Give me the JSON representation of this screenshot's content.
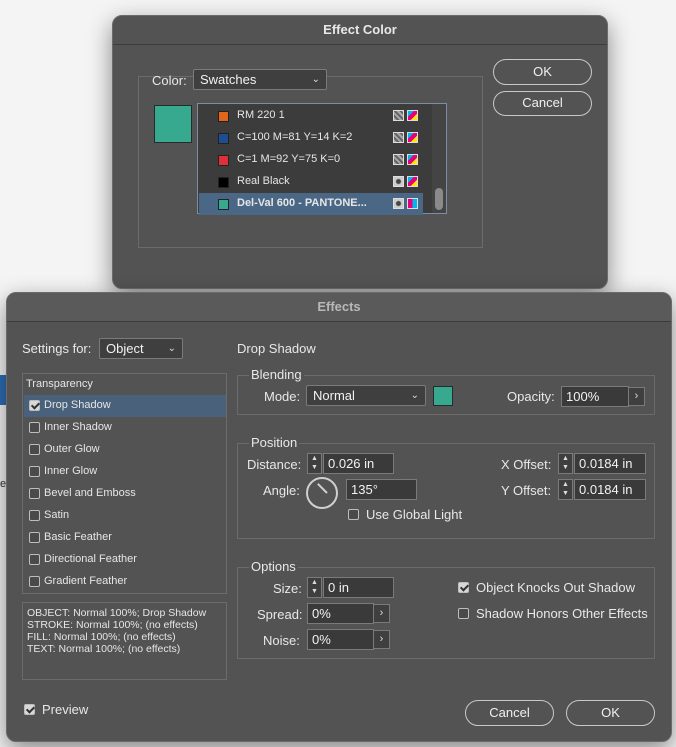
{
  "effect_color": {
    "title": "Effect Color",
    "color_label": "Color:",
    "color_value": "Swatches",
    "ok": "OK",
    "cancel": "Cancel",
    "preview_color": "#37a98f",
    "swatches": [
      {
        "name": "RM 220 1",
        "color": "#e0661c"
      },
      {
        "name": "C=100 M=81 Y=14 K=2",
        "color": "#1e4e92"
      },
      {
        "name": "C=1 M=92 Y=75 K=0",
        "color": "#df2f3a"
      },
      {
        "name": "Real Black",
        "color": "#000000"
      },
      {
        "name": "Del-Val 600 - PANTONE...",
        "color": "#37a98f",
        "selected": true
      }
    ]
  },
  "effects": {
    "title": "Effects",
    "settings_for_label": "Settings for:",
    "settings_for_value": "Object",
    "list_header": "Transparency",
    "items": [
      {
        "label": "Drop Shadow",
        "checked": true,
        "selected": true
      },
      {
        "label": "Inner Shadow",
        "checked": false
      },
      {
        "label": "Outer Glow",
        "checked": false
      },
      {
        "label": "Inner Glow",
        "checked": false
      },
      {
        "label": "Bevel and Emboss",
        "checked": false
      },
      {
        "label": "Satin",
        "checked": false
      },
      {
        "label": "Basic Feather",
        "checked": false
      },
      {
        "label": "Directional Feather",
        "checked": false
      },
      {
        "label": "Gradient Feather",
        "checked": false
      }
    ],
    "summary": [
      "OBJECT: Normal 100%; Drop Shadow",
      "STROKE: Normal 100%; (no effects)",
      "FILL: Normal 100%; (no effects)",
      "TEXT: Normal 100%; (no effects)"
    ],
    "preview_label": "Preview",
    "preview_checked": true,
    "panel_title": "Drop Shadow",
    "blending": {
      "title": "Blending",
      "mode_label": "Mode:",
      "mode_value": "Normal",
      "swatch_color": "#37a98f",
      "opacity_label": "Opacity:",
      "opacity_value": "100%"
    },
    "position": {
      "title": "Position",
      "distance_label": "Distance:",
      "distance_value": "0.026 in",
      "angle_label": "Angle:",
      "angle_value": "135°",
      "use_global_light": "Use Global Light",
      "x_offset_label": "X Offset:",
      "x_offset_value": "0.0184 in",
      "y_offset_label": "Y Offset:",
      "y_offset_value": "0.0184 in"
    },
    "options": {
      "title": "Options",
      "size_label": "Size:",
      "size_value": "0 in",
      "spread_label": "Spread:",
      "spread_value": "0%",
      "noise_label": "Noise:",
      "noise_value": "0%",
      "knocks_out": "Object Knocks Out Shadow",
      "knocks_out_checked": true,
      "honors_effects": "Shadow Honors Other Effects",
      "honors_effects_checked": false
    },
    "cancel": "Cancel",
    "ok": "OK"
  }
}
